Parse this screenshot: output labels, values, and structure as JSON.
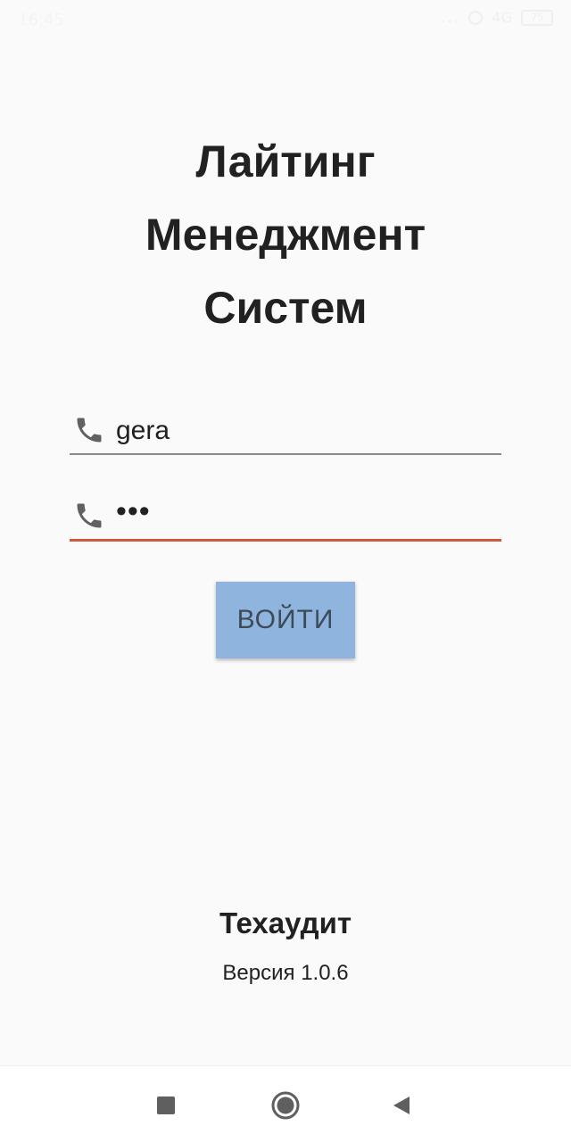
{
  "status_bar": {
    "time": "16:45",
    "dots": "...",
    "network": "4G",
    "battery": "75"
  },
  "title_lines": [
    "Лайтинг",
    "Менеджмент",
    "Систем"
  ],
  "login_field": {
    "value": "gera",
    "icon": "phone-icon"
  },
  "password_field": {
    "value": "•••",
    "icon": "phone-icon"
  },
  "login_button": {
    "label": "ВОЙТИ"
  },
  "footer": {
    "company": "Техаудит",
    "version": "Версия 1.0.6"
  },
  "nav": {
    "recent": "square-icon",
    "home": "circle-icon",
    "back": "triangle-back-icon"
  },
  "colors": {
    "background": "#fafafa",
    "button": "#8fb4de",
    "error_underline": "#d05a3f",
    "text": "#212121"
  }
}
